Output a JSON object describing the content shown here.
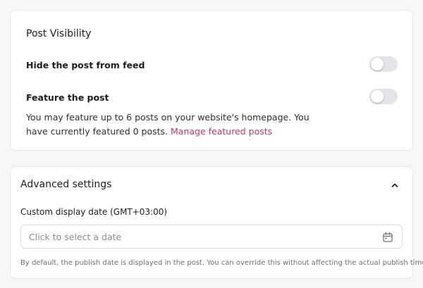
{
  "post_visibility": {
    "title": "Post Visibility",
    "hide_from_feed": {
      "label": "Hide the post from feed",
      "enabled": false
    },
    "feature_post": {
      "label": "Feature the post",
      "enabled": false
    },
    "feature_description": "You may feature up to 6 posts on your website's homepage. You have currently featured 0 posts.",
    "manage_link": "Manage featured posts"
  },
  "advanced_settings": {
    "title": "Advanced settings",
    "expanded": true,
    "collapse_icon": "chevron-up-icon",
    "custom_date_label": "Custom display date (GMT+03:00)",
    "date_placeholder": "Click to select a date",
    "date_icon": "calendar-icon",
    "help_text": "By default, the publish date is displayed in the post. You can override this without affecting the actual publish time."
  },
  "colors": {
    "accent_link": "#c4356b",
    "toggle_off": "#e3e3e8",
    "page_background": "#f7f7f8"
  }
}
